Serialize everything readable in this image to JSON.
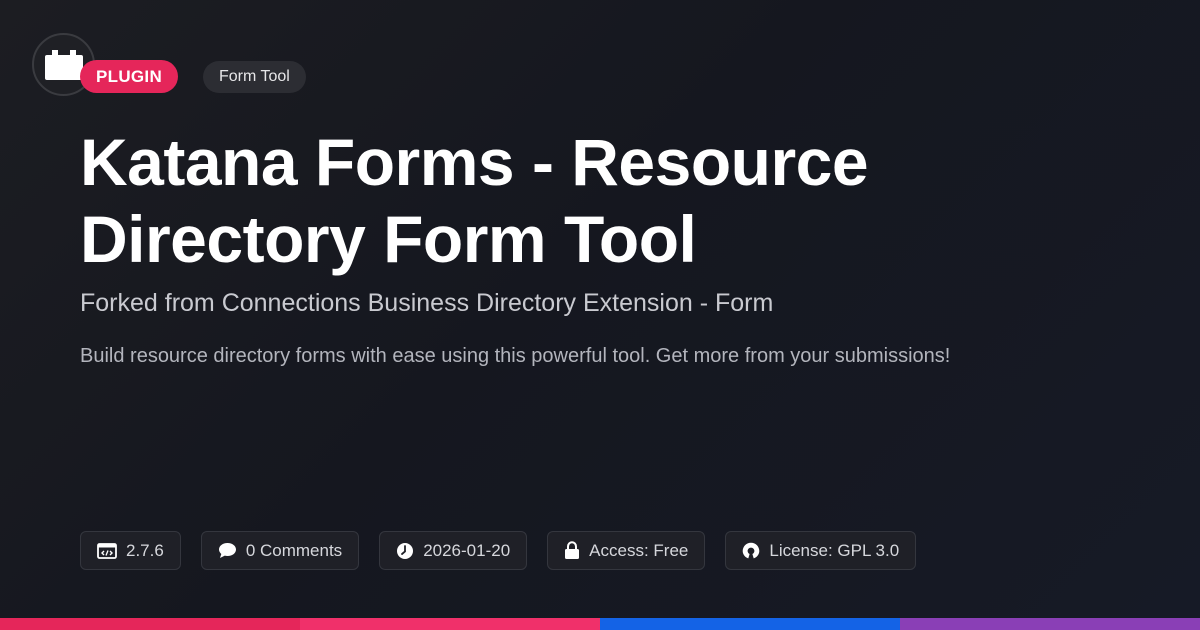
{
  "badges": {
    "category": "PLUGIN",
    "type": "Form Tool"
  },
  "title": "Katana Forms - Resource Directory Form Tool",
  "subtitle": "Forked from Connections Business Directory Extension - Form",
  "description": "Build resource directory forms with ease using this powerful tool. Get more from your submissions!",
  "meta": {
    "version": "2.7.6",
    "comments": "0 Comments",
    "date": "2026-01-20",
    "access": "Access: Free",
    "license": "License: GPL 3.0"
  },
  "icons": {
    "logo": "plugin-block-icon",
    "version": "code-window-icon",
    "comments": "speech-bubble-icon",
    "date": "clock-icon",
    "access": "lock-icon",
    "license": "open-source-icon"
  },
  "colors": {
    "accent": "#e5265a",
    "bar": [
      "#e5265a",
      "#f0306a",
      "#1463e6",
      "#8a3fb6"
    ]
  }
}
